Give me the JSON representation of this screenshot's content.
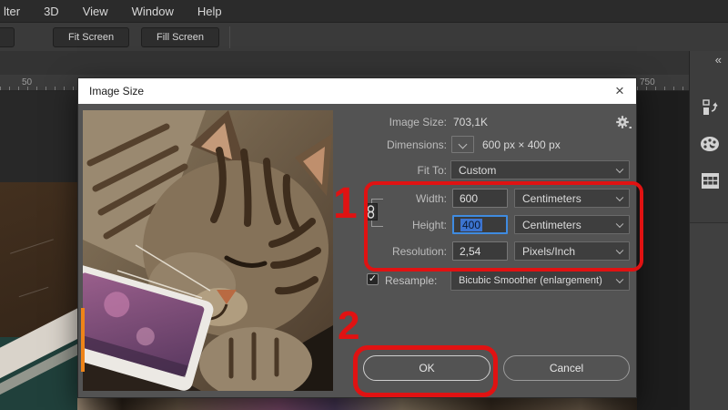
{
  "menu_bar": {
    "items": [
      "lter",
      "3D",
      "View",
      "Window",
      "Help"
    ]
  },
  "options_bar": {
    "fit_screen_label": "Fit Screen",
    "fill_screen_label": "Fill Screen"
  },
  "ruler": {
    "left_label": "50",
    "right_label": "750"
  },
  "right_dock": {
    "collapse_icon": "«",
    "icons": [
      "history-panel-icon",
      "color-panel-icon",
      "swatches-panel-icon"
    ]
  },
  "dialog": {
    "title": "Image Size",
    "close_icon": "×",
    "info": {
      "label": "Image Size:",
      "value": "703,1K",
      "gear_icon": "gear"
    },
    "dimensions": {
      "label": "Dimensions:",
      "value": "600 px  ×  400 px"
    },
    "fit_to": {
      "label": "Fit To:",
      "value": "Custom"
    },
    "fields": {
      "width": {
        "label": "Width:",
        "value": "600",
        "unit": "Centimeters"
      },
      "height": {
        "label": "Height:",
        "value": "400",
        "unit": "Centimeters",
        "selected": true
      },
      "resolution": {
        "label": "Resolution:",
        "value": "2,54",
        "unit": "Pixels/Inch"
      }
    },
    "resample": {
      "label": "Resample:",
      "checked": true,
      "check_glyph": "✓",
      "value": "Bicubic Smoother (enlargement)"
    },
    "buttons": {
      "ok_label": "OK",
      "cancel_label": "Cancel"
    }
  },
  "annotations": {
    "step1": "1",
    "step2": "2",
    "highlight_color": "#e01212"
  },
  "colors": {
    "selection_blue": "#3c74d0",
    "focus_border_blue": "#3f8be0",
    "annotation_red": "#e01212",
    "orange_marker": "#ef8418",
    "dialog_bg": "#535353",
    "titlebar_bg": "#ffffff"
  }
}
